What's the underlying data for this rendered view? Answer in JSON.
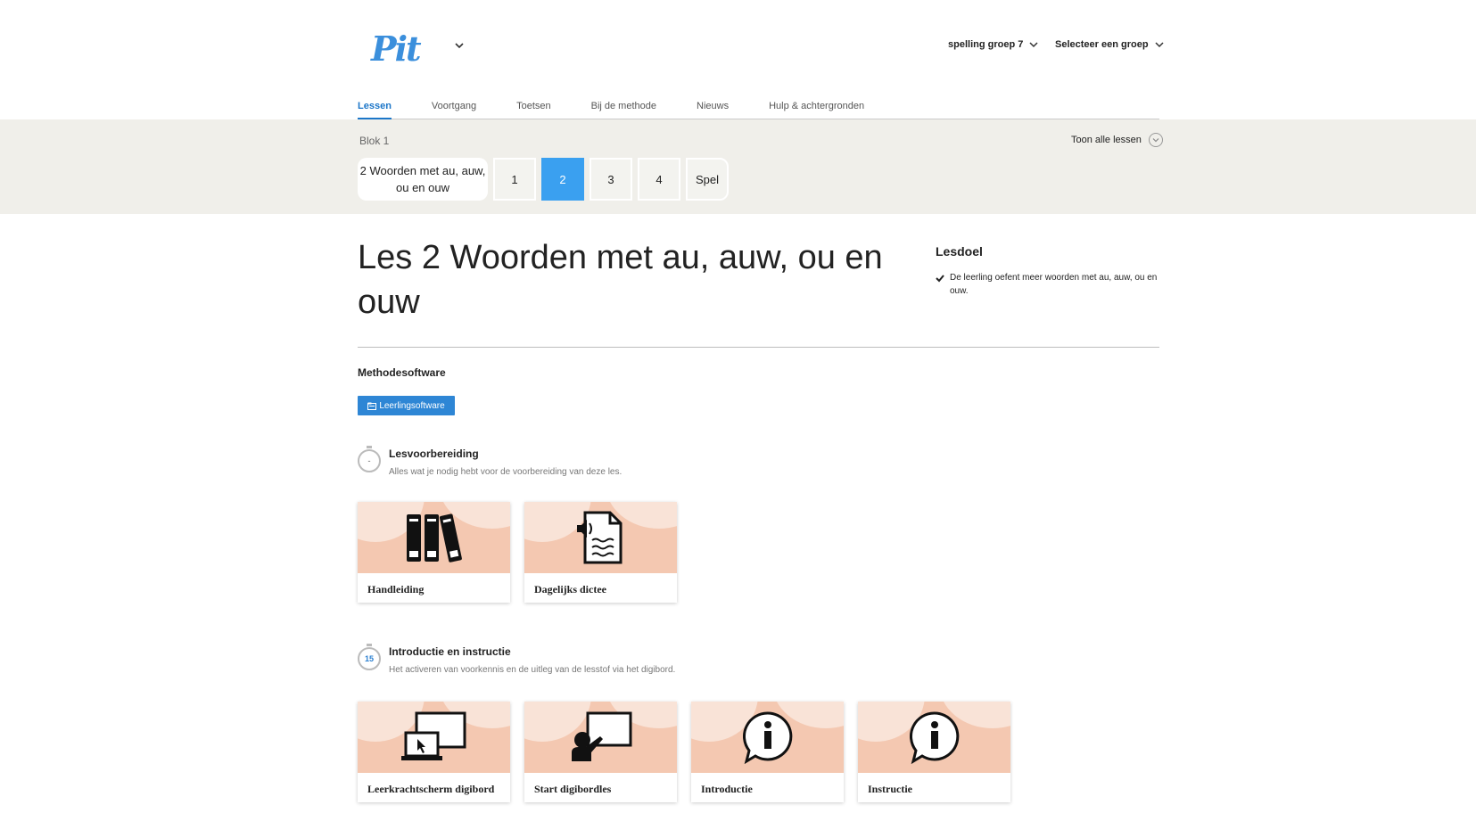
{
  "header": {
    "logo": "Pit",
    "method_select": "spelling groep 7",
    "group_select": "Selecteer een groep"
  },
  "nav": {
    "items": [
      "Lessen",
      "Voortgang",
      "Toetsen",
      "Bij de methode",
      "Nieuws",
      "Hulp & achtergronden"
    ],
    "active_index": 0
  },
  "block": {
    "label": "Blok 1",
    "toon_alle": "Toon alle lessen",
    "lesson_title_short": "2 Woorden met au, auw, ou en ouw",
    "lessons": [
      "1",
      "2",
      "3",
      "4",
      "Spel"
    ],
    "active_lesson": "2"
  },
  "main": {
    "title": "Les 2 Woorden met au, auw, ou en ouw",
    "lesdoel_heading": "Lesdoel",
    "lesdoel_text": "De leerling oefent meer woorden met au, auw, ou en ouw.",
    "methode_title": "Methodesoftware",
    "leerling_button": "Leerlingsoftware"
  },
  "sections": [
    {
      "timer": "-",
      "title": "Lesvoorbereiding",
      "desc": "Alles wat je nodig hebt voor de voorbereiding van deze les.",
      "cards": [
        {
          "label": "Handleiding",
          "icon": "books-icon"
        },
        {
          "label": "Dagelijks dictee",
          "icon": "audio-document-icon"
        }
      ]
    },
    {
      "timer": "15",
      "title": "Introductie en instructie",
      "desc": "Het activeren van voorkennis en de uitleg van de lesstof via het digibord.",
      "cards": [
        {
          "label": "Leerkrachtscherm digibord",
          "icon": "laptop-screen-icon"
        },
        {
          "label": "Start digibordles",
          "icon": "teacher-board-icon"
        },
        {
          "label": "Introductie",
          "icon": "info-speech-icon"
        },
        {
          "label": "Instructie",
          "icon": "info-speech-icon"
        }
      ]
    }
  ],
  "colors": {
    "accent": "#1c76c8",
    "active_lesson": "#3aa0f0",
    "card_peach": "#f4c8b1",
    "band": "#f0efea"
  }
}
